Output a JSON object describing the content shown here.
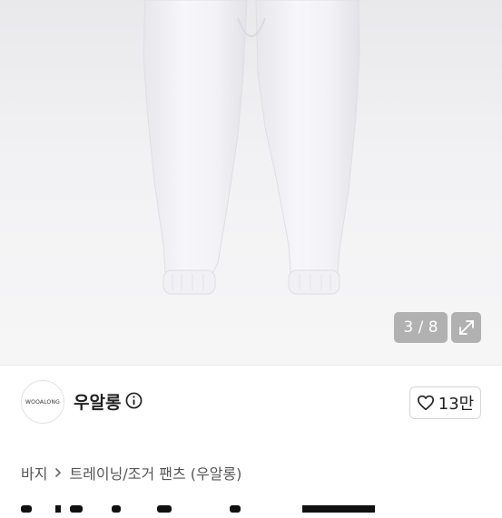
{
  "gallery": {
    "image_alt": "white jogger pants product photo",
    "counter": "3 / 8",
    "expand_icon": "expand-arrows-icon"
  },
  "seller": {
    "avatar_text": "WOOALONG",
    "name": "우알롱",
    "info_icon": "info-circle-icon",
    "likes": "13만",
    "like_icon": "heart-outline-icon"
  },
  "breadcrumb": {
    "level1": "바지",
    "level2": "트레이닝/조거 팬츠 (우알롱)"
  }
}
